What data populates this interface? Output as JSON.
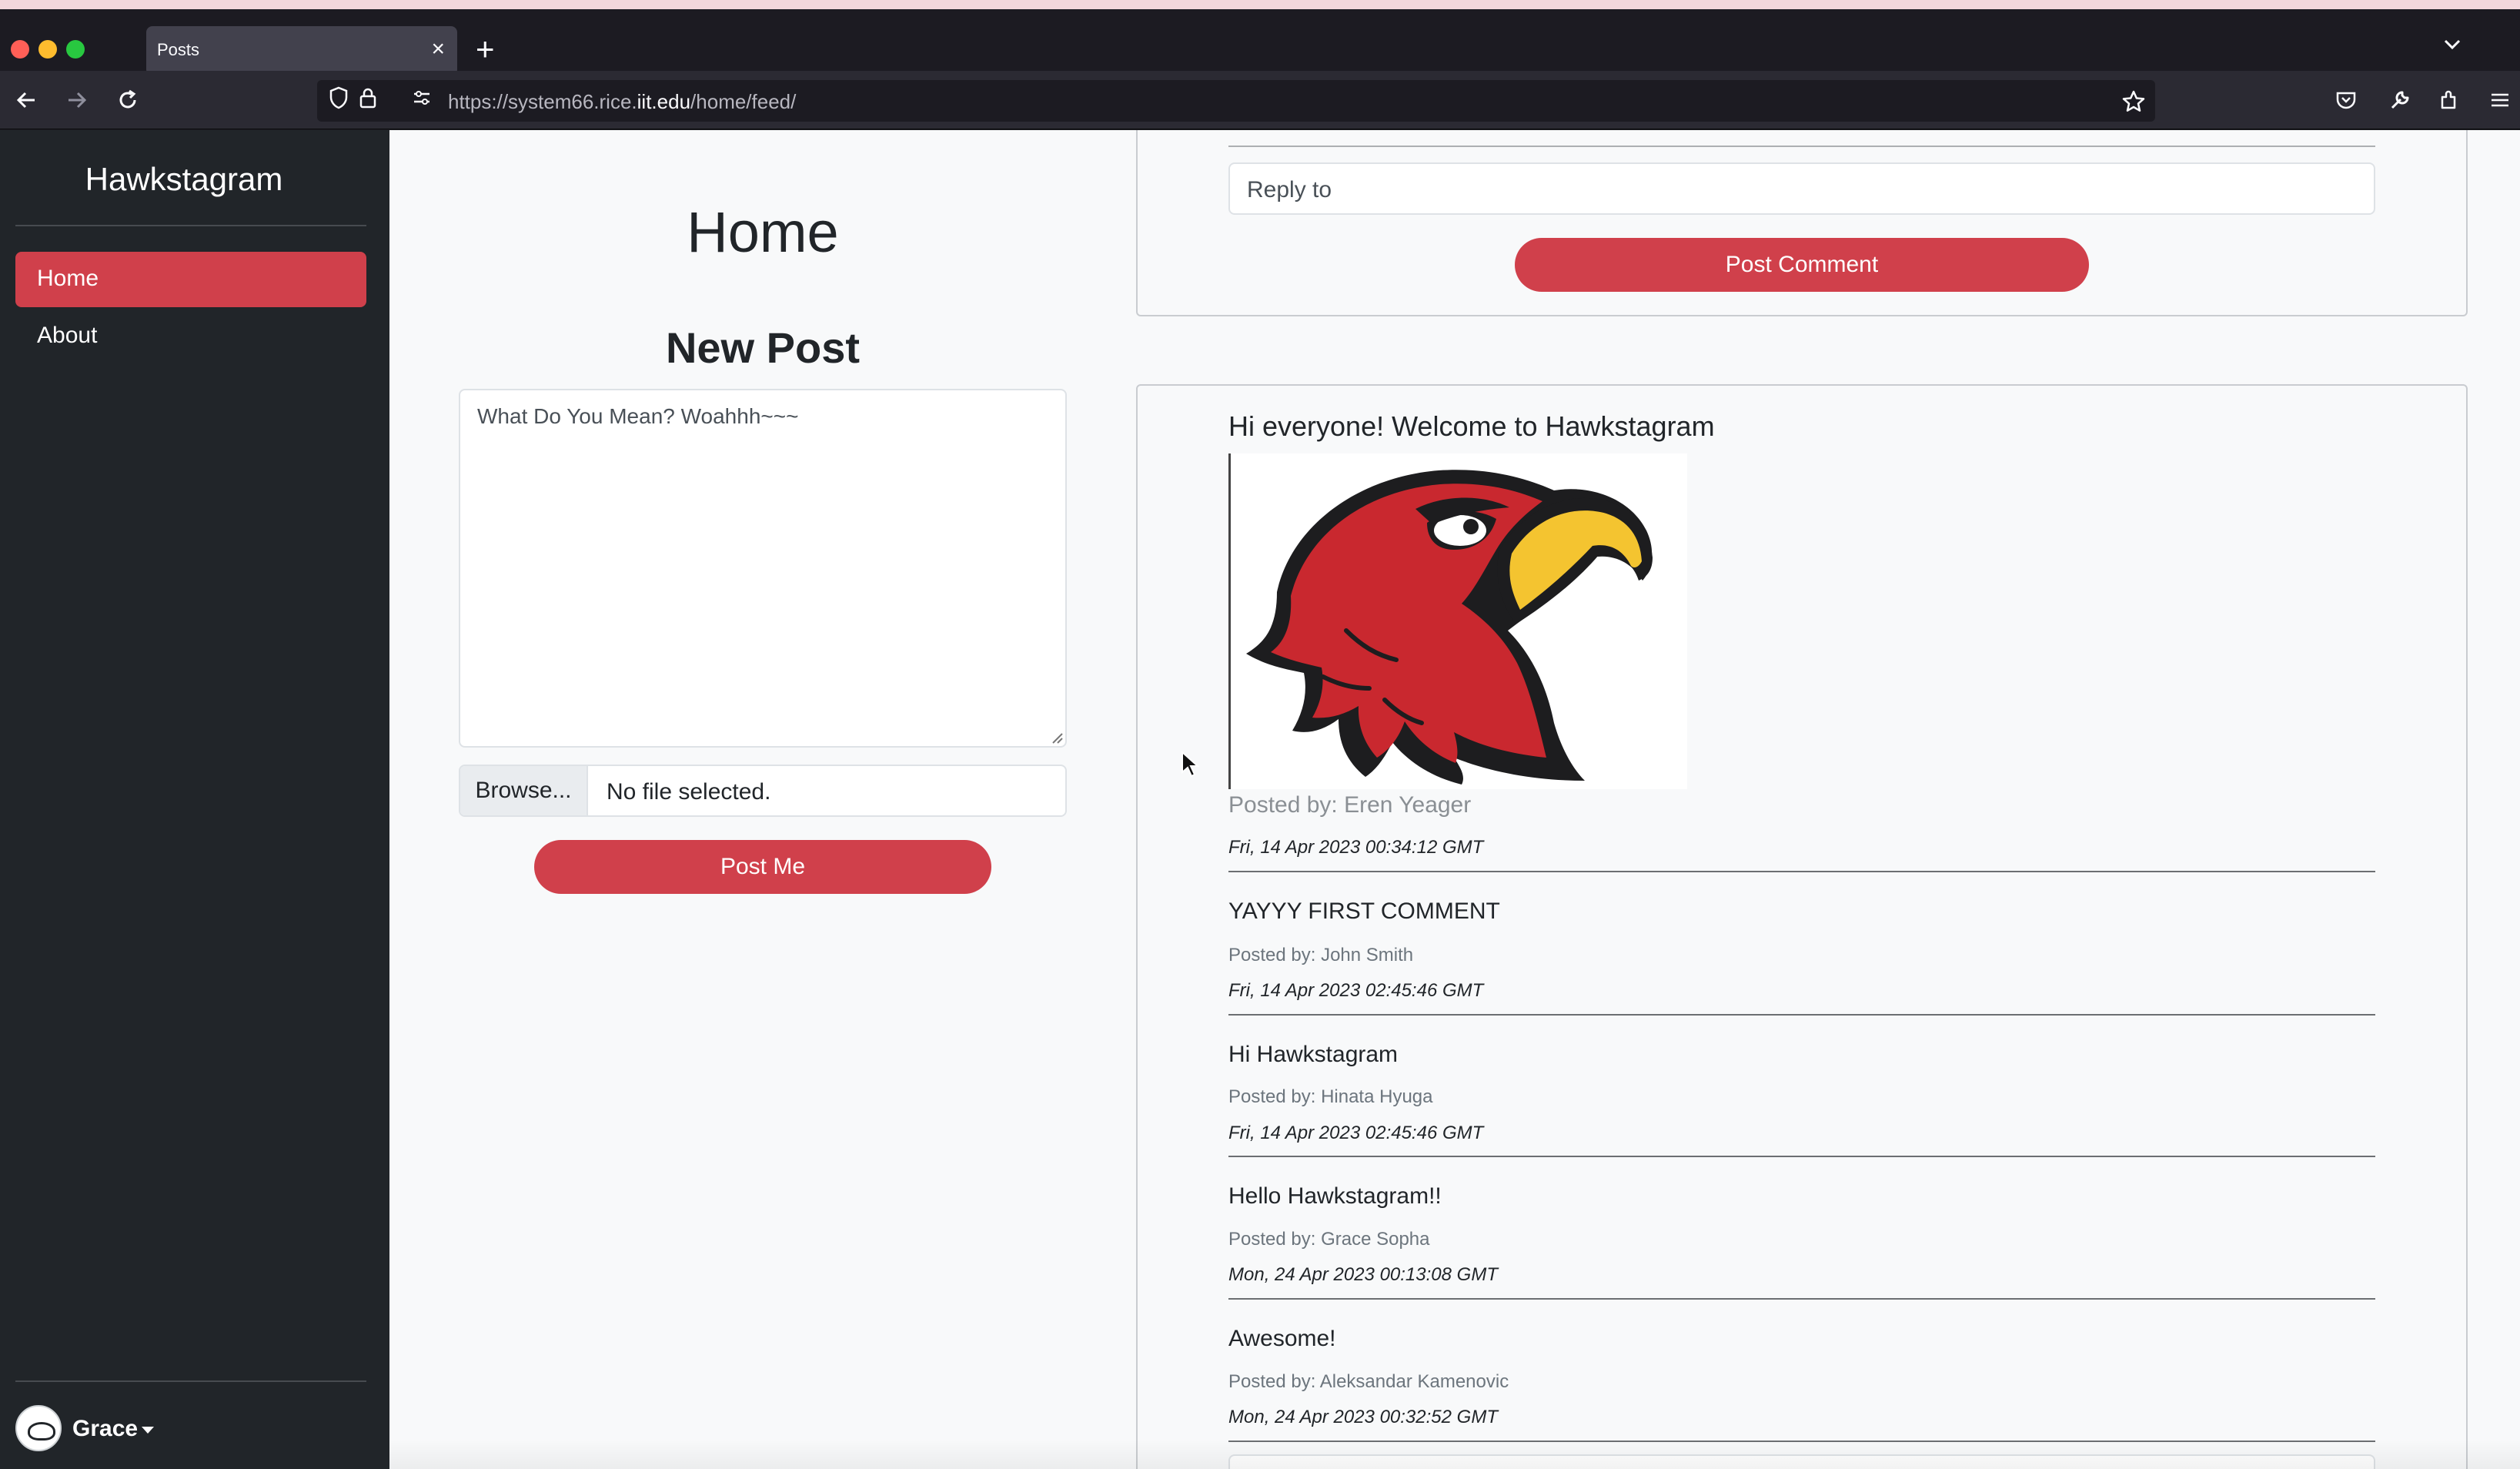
{
  "browser": {
    "tab_title": "Posts",
    "tab_close": "×",
    "new_tab": "+",
    "tab_list": "⌄",
    "url_prefix": "https://system66.rice.",
    "url_domain": "iit.edu",
    "url_path": "/home/feed/"
  },
  "sidebar": {
    "brand": "Hawkstagram",
    "items": [
      {
        "label": "Home",
        "active": true
      },
      {
        "label": "About",
        "active": false
      }
    ],
    "user": "Grace"
  },
  "new_post": {
    "page_title": "Home",
    "heading": "New Post",
    "textarea_value": "What Do You Mean? Woahhh~~~",
    "browse_label": "Browse...",
    "file_status": "No file selected.",
    "submit_label": "Post Me"
  },
  "feed": {
    "reply_placeholder": "Reply to",
    "post_comment_label": "Post Comment",
    "post": {
      "title": "Hi everyone! Welcome to Hawkstagram",
      "posted_by": "Posted by: Eren Yeager",
      "date": "Fri, 14 Apr 2023 00:34:12 GMT"
    },
    "comments": [
      {
        "text": "YAYYY FIRST COMMENT",
        "by": "Posted by: John Smith",
        "date": "Fri, 14 Apr 2023 02:45:46 GMT"
      },
      {
        "text": "Hi Hawkstagram",
        "by": "Posted by: Hinata Hyuga",
        "date": "Fri, 14 Apr 2023 02:45:46 GMT"
      },
      {
        "text": "Hello Hawkstagram!!",
        "by": "Posted by: Grace Sopha",
        "date": "Mon, 24 Apr 2023 00:13:08 GMT"
      },
      {
        "text": "Awesome!",
        "by": "Posted by: Aleksandar Kamenovic",
        "date": "Mon, 24 Apr 2023 00:32:52 GMT"
      }
    ]
  },
  "colors": {
    "accent": "#d0404b",
    "sidebar_bg": "#212529",
    "page_bg": "#f8f9fa",
    "browser_bg": "#1c1b22",
    "hawk_red": "#c9282f",
    "hawk_yellow": "#f4c430"
  },
  "icons": [
    "shield-icon",
    "lock-icon",
    "permissions-icon",
    "star-icon",
    "pocket-icon",
    "wrench-icon",
    "extensions-icon",
    "menu-icon",
    "back-icon",
    "forward-icon",
    "reload-icon",
    "hawk-logo"
  ]
}
